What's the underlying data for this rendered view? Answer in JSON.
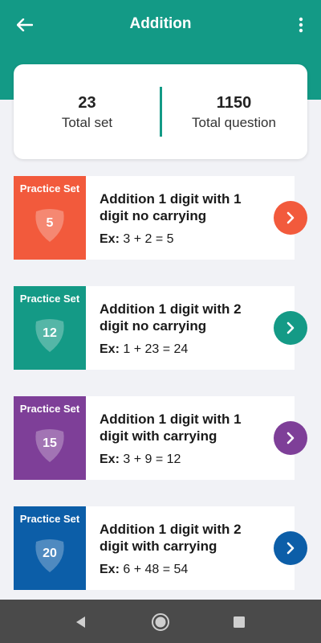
{
  "appbar": {
    "title": "Addition",
    "back_icon": "arrow-left-icon",
    "more_icon": "more-vert-icon"
  },
  "stats": {
    "total_set": {
      "value": "23",
      "label": "Total set"
    },
    "total_question": {
      "value": "1150",
      "label": "Total question"
    }
  },
  "sets": [
    {
      "badge_label": "Practice Set",
      "number": "5",
      "title": "Addition 1 digit with 1 digit no carrying",
      "ex_label": "Ex:",
      "example": "3 + 2 = 5",
      "color": "#f25a3c"
    },
    {
      "badge_label": "Practice Set",
      "number": "12",
      "title": "Addition 1 digit with 2 digit no carrying",
      "ex_label": "Ex:",
      "example": "1 + 23 = 24",
      "color": "#149a86"
    },
    {
      "badge_label": "Practice Set",
      "number": "15",
      "title": "Addition 1 digit with 1 digit with carrying",
      "ex_label": "Ex:",
      "example": "3 + 9 = 12",
      "color": "#7e3f98"
    },
    {
      "badge_label": "Practice Set",
      "number": "20",
      "title": "Addition 1 digit with 2 digit with carrying",
      "ex_label": "Ex:",
      "example": "6 + 48 = 54",
      "color": "#0c5ea8"
    }
  ],
  "colors": {
    "primary": "#139a86",
    "nav_bar": "#4a4a4a",
    "background": "#f1f2f6"
  },
  "navbar": {
    "back_icon": "nav-back-triangle-icon",
    "home_icon": "nav-home-circle-icon",
    "recents_icon": "nav-recents-square-icon"
  }
}
